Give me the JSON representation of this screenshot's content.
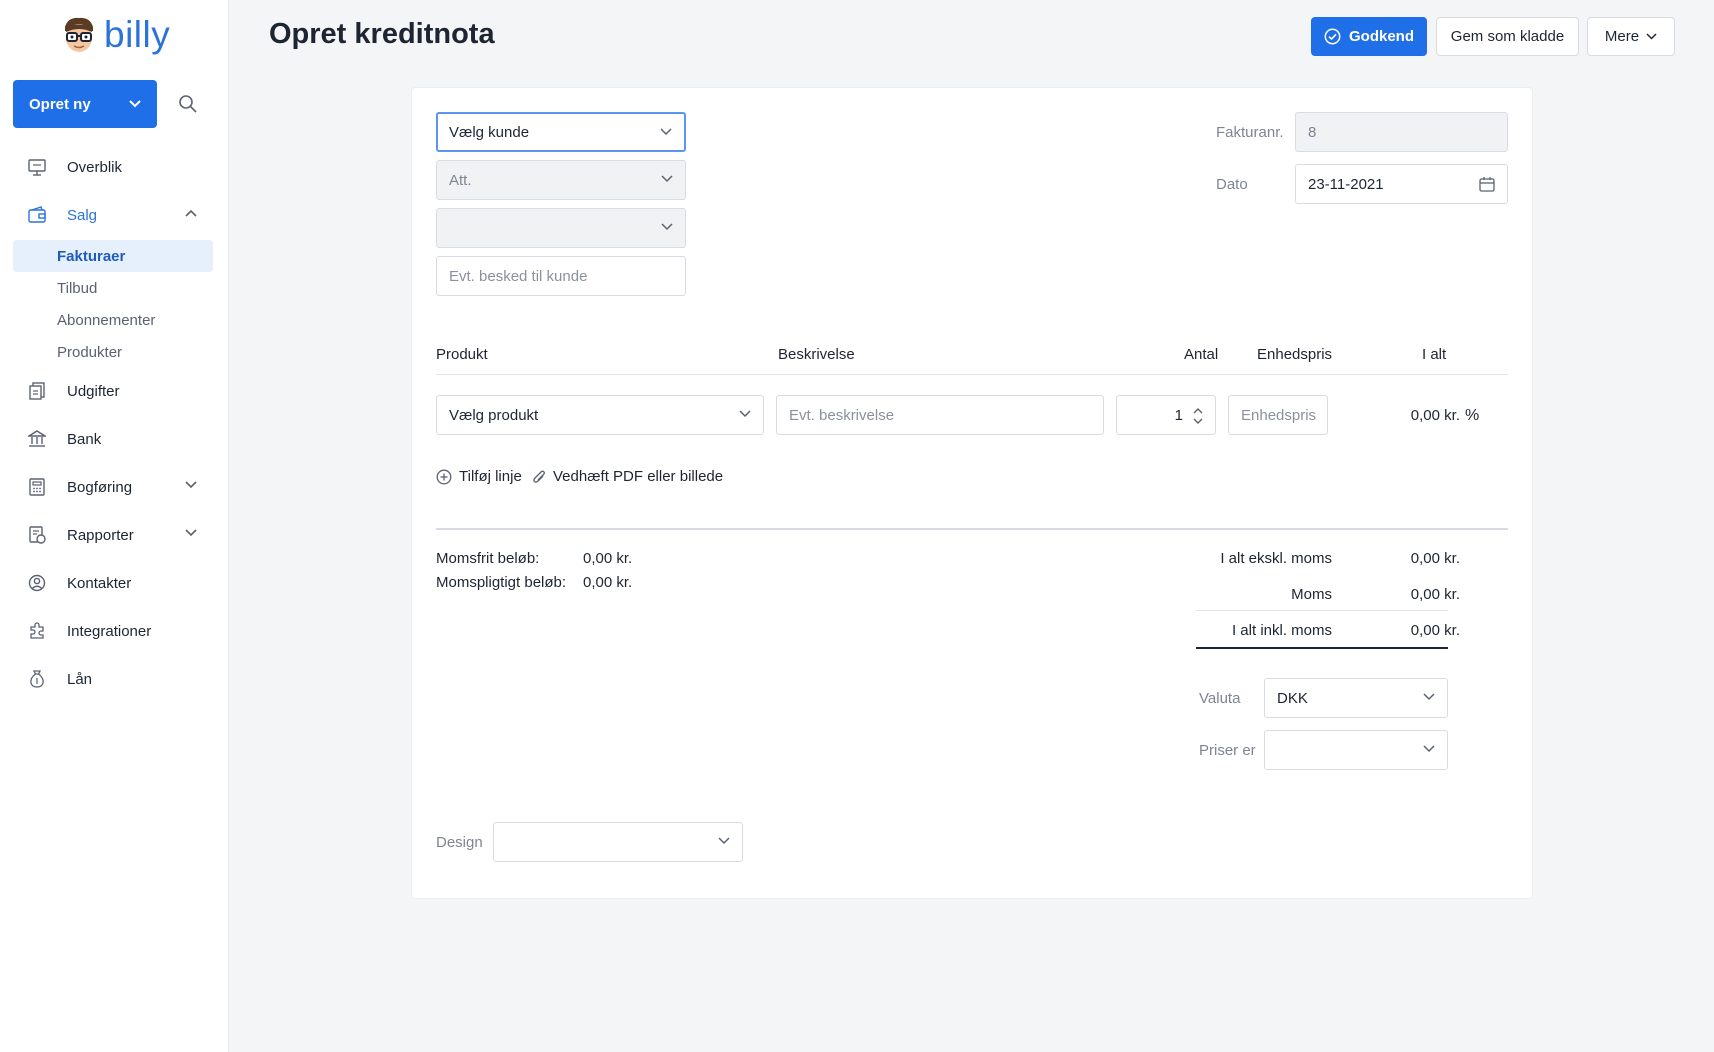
{
  "brand": {
    "logo_text": "billy",
    "accent": "#1f6fe8"
  },
  "sidebar": {
    "create_label": "Opret ny",
    "items": [
      {
        "label": "Overblik",
        "icon": "dashboard-icon"
      },
      {
        "label": "Salg",
        "icon": "sales-icon",
        "expanded": true
      },
      {
        "label": "Udgifter",
        "icon": "expenses-icon"
      },
      {
        "label": "Bank",
        "icon": "bank-icon"
      },
      {
        "label": "Bogføring",
        "icon": "ledger-icon"
      },
      {
        "label": "Rapporter",
        "icon": "reports-icon"
      },
      {
        "label": "Kontakter",
        "icon": "contacts-icon"
      },
      {
        "label": "Integrationer",
        "icon": "integrations-icon"
      },
      {
        "label": "Lån",
        "icon": "loan-icon"
      }
    ],
    "sub_items": [
      "Fakturaer",
      "Tilbud",
      "Abonnementer",
      "Produkter"
    ]
  },
  "header": {
    "title": "Opret kreditnota",
    "approve_label": "Godkend",
    "draft_label": "Gem som kladde",
    "more_label": "Mere"
  },
  "form": {
    "customer_placeholder": "Vælg kunde",
    "att_placeholder": "Att.",
    "message_placeholder": "Evt. besked til kunde",
    "invoice_no_label": "Fakturanr.",
    "invoice_no": "8",
    "date_label": "Dato",
    "date": "23-11-2021"
  },
  "lines": {
    "headers": {
      "product": "Produkt",
      "description": "Beskrivelse",
      "qty": "Antal",
      "unit_price": "Enhedspris",
      "total": "I alt"
    },
    "row": {
      "product_placeholder": "Vælg produkt",
      "description_placeholder": "Evt. beskrivelse",
      "qty": "1",
      "unit_price_placeholder": "Enhedspris",
      "total": "0,00 kr.",
      "percent": "%"
    },
    "add_line_label": "Tilføj linje",
    "attach_label": "Vedhæft PDF eller billede"
  },
  "totals": {
    "vat_free_label": "Momsfrit beløb:",
    "vat_free_value": "0,00 kr.",
    "vat_liable_label": "Momspligtigt beløb:",
    "vat_liable_value": "0,00 kr.",
    "excl_label": "I alt ekskl. moms",
    "excl_value": "0,00 kr.",
    "vat_label": "Moms",
    "vat_value": "0,00 kr.",
    "incl_label": "I alt inkl. moms",
    "incl_value": "0,00 kr."
  },
  "settings": {
    "currency_label": "Valuta",
    "currency": "DKK",
    "prices_label": "Priser er",
    "design_label": "Design"
  }
}
